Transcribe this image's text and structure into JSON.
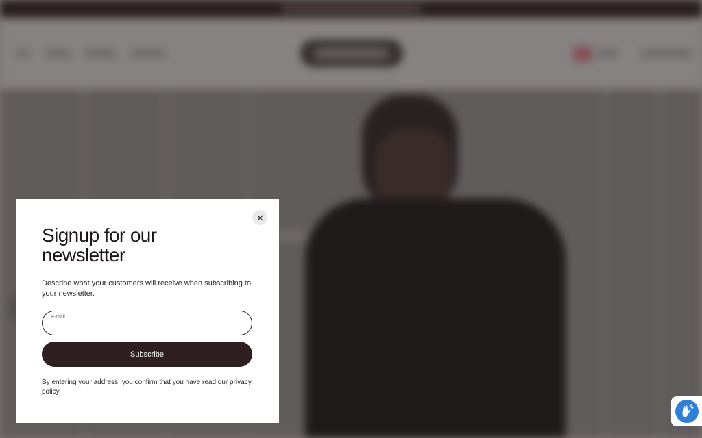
{
  "modal": {
    "title": "Signup for our newsletter",
    "description": "Describe what your customers will receive when subscribing to your newsletter.",
    "email_label": "E-mail",
    "email_value": "",
    "subscribe_label": "Subscribe",
    "legal": "By entering your address, you confirm that you have read our privacy policy.",
    "close_icon": "close-icon"
  },
  "accessibility_widget": {
    "icon": "accessibility-hand-icon",
    "color": "#2f7fd6"
  },
  "colors": {
    "button_bg": "#2e1f20",
    "announce_bar": "#2a1e1f"
  }
}
